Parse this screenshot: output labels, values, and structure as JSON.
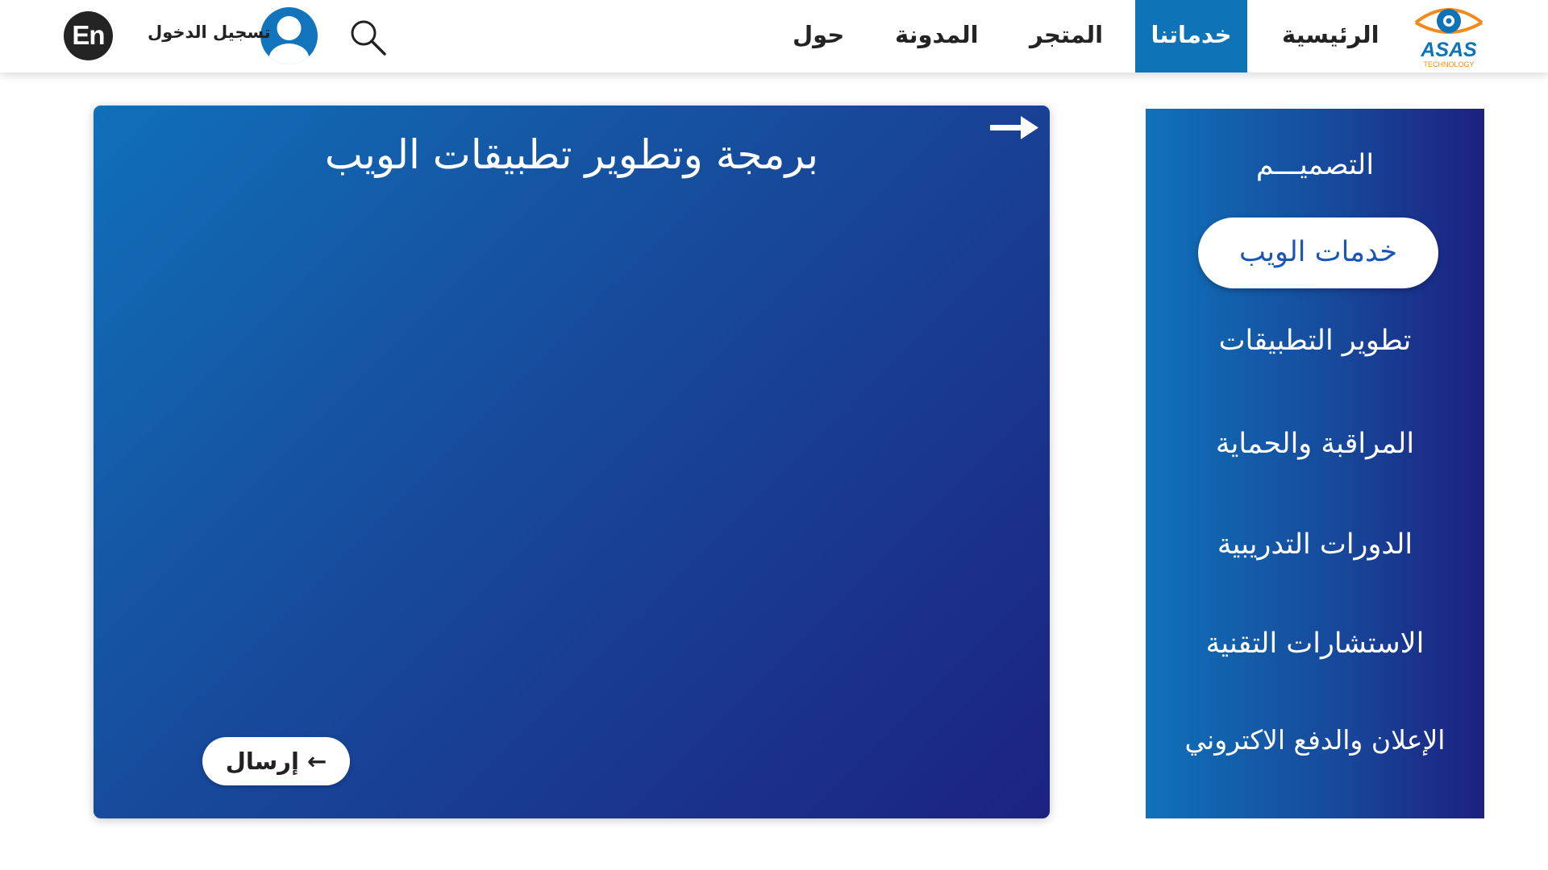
{
  "header": {
    "logo_text": "ASAS",
    "logo_subtext": "TECHNOLOGY",
    "nav": [
      {
        "label": "الرئيسية"
      },
      {
        "label": "خدماتنا"
      },
      {
        "label": "المتجر"
      },
      {
        "label": "المدونة"
      },
      {
        "label": "حول"
      }
    ],
    "active_nav": "خدماتنا",
    "login_label": "تسجيل الدخول",
    "language_toggle": "En",
    "icons": {
      "search": "search-icon",
      "user": "user-avatar-icon",
      "logo": "eye-logo"
    }
  },
  "card": {
    "title": "برمجة وتطوير تطبيقات الويب",
    "send_label": "إرسال ←",
    "icons": {
      "corner": "arrow-right-icon"
    }
  },
  "sidebar": {
    "items": [
      {
        "label": "التصميـــم"
      },
      {
        "label": "خدمات الويب",
        "active": true
      },
      {
        "label": "تطوير التطبيقات"
      },
      {
        "label": "المراقبة والحماية"
      },
      {
        "label": "الدورات التدريبية"
      },
      {
        "label": "الاستشارات التقنية"
      },
      {
        "label": "الإعلان والدفع الاكتروني"
      }
    ]
  },
  "colors": {
    "accent": "#0f73b8",
    "gradient_start": "#1070b8",
    "gradient_end": "#1c2282",
    "logo_orange": "#f28a1c",
    "text_dark": "#232323"
  }
}
